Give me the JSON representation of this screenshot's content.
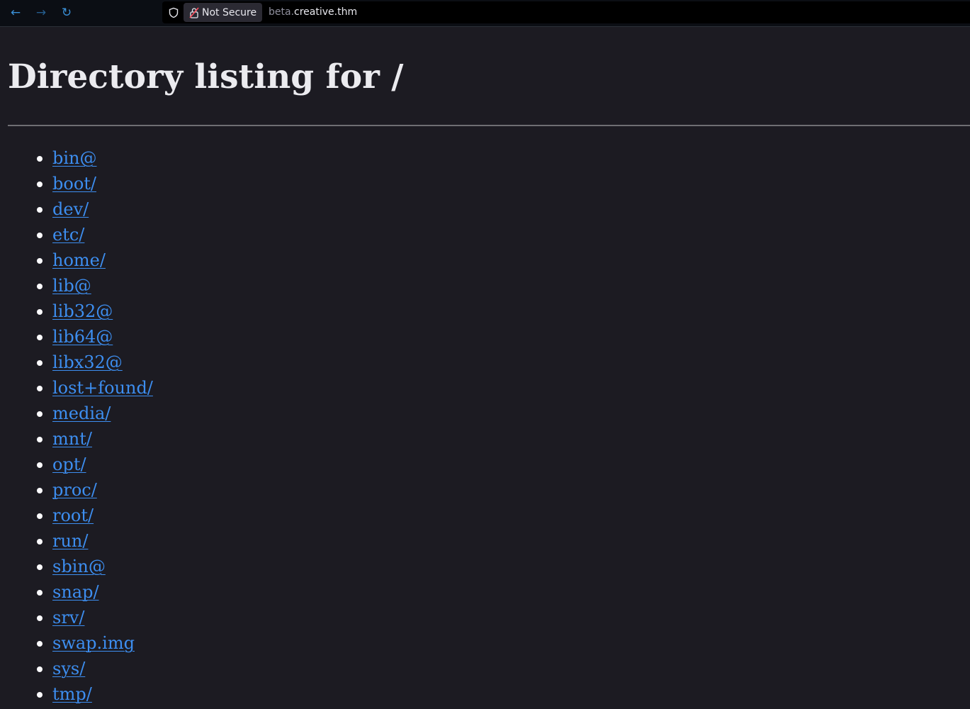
{
  "browser": {
    "nav": {
      "back_icon": "arrow-left-icon",
      "forward_icon": "arrow-right-icon",
      "reload_icon": "reload-icon"
    },
    "security_label": "Not Secure",
    "url_subdomain": "beta.",
    "url_domain": "creative.thm"
  },
  "page": {
    "title": "Directory listing for /",
    "entries": [
      "bin@",
      "boot/",
      "dev/",
      "etc/",
      "home/",
      "lib@",
      "lib32@",
      "lib64@",
      "libx32@",
      "lost+found/",
      "media/",
      "mnt/",
      "opt/",
      "proc/",
      "root/",
      "run/",
      "sbin@",
      "snap/",
      "srv/",
      "swap.img",
      "sys/",
      "tmp/"
    ]
  },
  "colors": {
    "background": "#1c1b22",
    "link": "#3d8ef0",
    "toolbar": "#0b0e14"
  }
}
